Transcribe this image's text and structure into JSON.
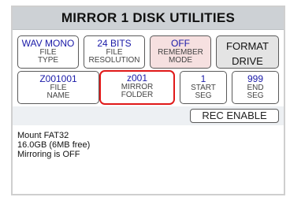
{
  "title": "MIRROR 1 DISK UTILITIES",
  "row1": [
    {
      "value": "WAV MONO",
      "line1": "FILE",
      "line2": "TYPE"
    },
    {
      "value": "24 BITS",
      "line1": "FILE",
      "line2": "RESOLUTION"
    },
    {
      "value": "OFF",
      "line1": "REMEMBER",
      "line2": "MODE"
    }
  ],
  "format_button": {
    "line1": "FORMAT",
    "line2": "DRIVE"
  },
  "row2": [
    {
      "value": "Z001001",
      "line1": "FILE",
      "line2": "NAME"
    },
    {
      "value": "z001",
      "line1": "MIRROR",
      "line2": "FOLDER"
    },
    {
      "value": "1",
      "line1": "START",
      "line2": "SEG"
    },
    {
      "value": "999",
      "line1": "END",
      "line2": "SEG"
    }
  ],
  "rec_enable": "REC ENABLE",
  "status_lines": [
    "Mount FAT32",
    "16.0GB (6MB free)",
    "Mirroring is OFF"
  ],
  "colors": {
    "title_bg": "#cdd1d5",
    "value_text": "#1a1aa8",
    "highlight_border": "#e01919",
    "remember_bg": "#f6e0e0",
    "format_bg": "#e4e4e4"
  }
}
